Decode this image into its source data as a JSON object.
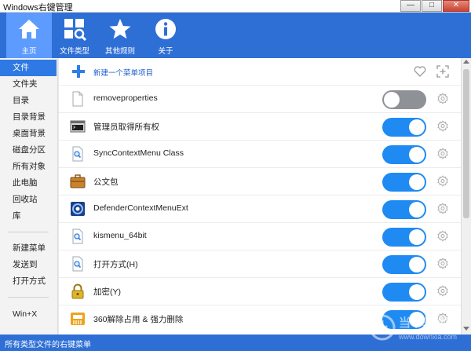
{
  "window": {
    "title": "Windows右键管理",
    "min_glyph": "—",
    "max_glyph": "□",
    "close_glyph": "✕"
  },
  "toolbar": {
    "items": [
      {
        "label": "主页",
        "icon": "home-icon",
        "active": true
      },
      {
        "label": "文件类型",
        "icon": "file-types-icon",
        "active": false
      },
      {
        "label": "其他规则",
        "icon": "star-icon",
        "active": false
      },
      {
        "label": "关于",
        "icon": "info-icon",
        "active": false
      }
    ]
  },
  "sidebar": {
    "items": [
      {
        "label": "文件",
        "active": true
      },
      {
        "label": "文件夹"
      },
      {
        "label": "目录"
      },
      {
        "label": "目录背景"
      },
      {
        "label": "桌面背景"
      },
      {
        "label": "磁盘分区"
      },
      {
        "label": "所有对象"
      },
      {
        "label": "此电脑"
      },
      {
        "label": "回收站"
      },
      {
        "label": "库"
      },
      {
        "label": "新建菜单"
      },
      {
        "label": "发送到"
      },
      {
        "label": "打开方式"
      },
      {
        "label": "Win+X"
      }
    ]
  },
  "main": {
    "add_label": "新建一个菜单项目",
    "rows": [
      {
        "name": "removeproperties",
        "icon": "blank-file-icon",
        "enabled": false
      },
      {
        "name": "管理员取得所有权",
        "icon": "console-icon",
        "enabled": true
      },
      {
        "name": "SyncContextMenu Class",
        "icon": "magnifier-file-icon",
        "enabled": true
      },
      {
        "name": "公文包",
        "icon": "briefcase-icon",
        "enabled": true
      },
      {
        "name": "DefenderContextMenuExt",
        "icon": "defender-icon",
        "enabled": true
      },
      {
        "name": "kismenu_64bit",
        "icon": "magnifier-file-icon",
        "enabled": true
      },
      {
        "name": "打开方式(H)",
        "icon": "magnifier-file-icon",
        "enabled": true
      },
      {
        "name": "加密(Y)",
        "icon": "padlock-icon",
        "enabled": true
      },
      {
        "name": "360解除占用 & 强力删除",
        "icon": "shredder-icon",
        "enabled": true
      }
    ]
  },
  "status": {
    "text": "所有类型文件的右键菜单"
  },
  "watermark": {
    "title": "当下软件园",
    "sub": "www.downxia.com"
  },
  "colors": {
    "accent": "#2e6fd6",
    "toggle_on": "#1f8af2",
    "toggle_off": "#8e9196"
  }
}
